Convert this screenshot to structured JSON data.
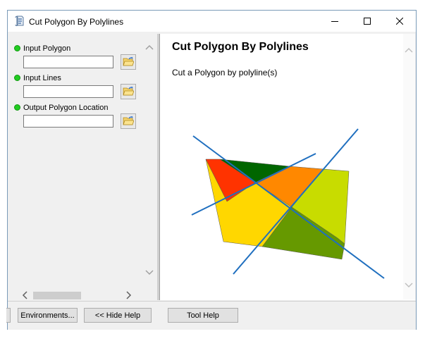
{
  "window": {
    "title": "Cut Polygon By Polylines",
    "icon": "python-script-icon",
    "controls": [
      "minimize-icon",
      "maximize-icon",
      "close-icon"
    ]
  },
  "parameters": [
    {
      "label": "Input Polygon",
      "value": "",
      "required": true
    },
    {
      "label": "Input Lines",
      "value": "",
      "required": true
    },
    {
      "label": "Output Polygon Location",
      "value": "",
      "required": true
    }
  ],
  "help": {
    "title": "Cut Polygon By Polylines",
    "description": "Cut a Polygon by polyline(s)",
    "illustration": {
      "colors": {
        "red": "#ff3300",
        "dark_green": "#006600",
        "orange": "#ff8800",
        "yellow": "#ffd700",
        "yellow_green": "#c8dc00",
        "olive_green": "#669900",
        "line_blue": "#1f6fbf"
      }
    }
  },
  "buttons": {
    "environments": "Environments...",
    "hide_help": "<< Hide Help",
    "tool_help": "Tool Help"
  }
}
